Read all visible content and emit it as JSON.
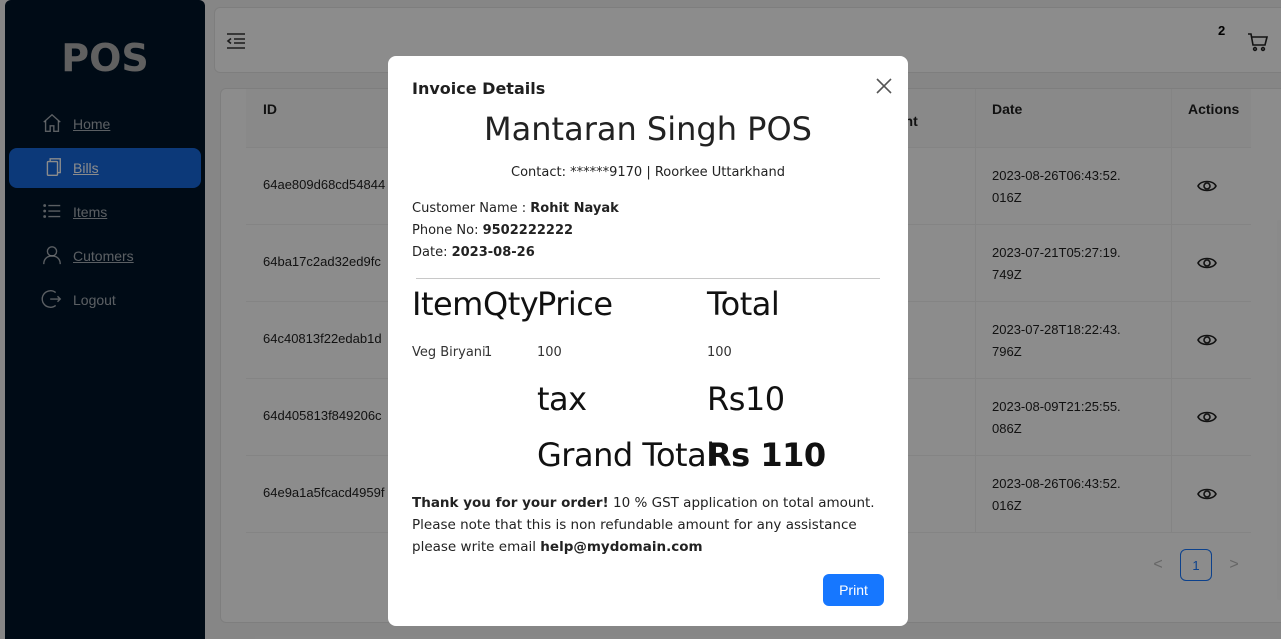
{
  "app": {
    "logo": "POS"
  },
  "sidebar": {
    "items": [
      {
        "label": "Home",
        "icon": "home-icon"
      },
      {
        "label": "Bills",
        "icon": "copy-icon"
      },
      {
        "label": "Items",
        "icon": "list-icon"
      },
      {
        "label": "Cutomers",
        "icon": "user-icon"
      },
      {
        "label": "Logout",
        "icon": "logout-icon"
      }
    ],
    "active_index": 1
  },
  "header": {
    "cart_count": "2"
  },
  "table": {
    "columns": [
      "ID",
      "Date",
      "Actions"
    ],
    "partial_column": "unt",
    "rows": [
      {
        "id": "64ae809d68cd54844",
        "date": "2023-08-26T06:43:52.016Z"
      },
      {
        "id": "64ba17c2ad32ed9fc",
        "date": "2023-07-21T05:27:19.749Z"
      },
      {
        "id": "64c40813f22edab1d",
        "date": "2023-07-28T18:22:43.796Z"
      },
      {
        "id": "64d405813f849206c",
        "date": "2023-08-09T21:25:55.086Z"
      },
      {
        "id": "64e9a1a5fcacd4959f",
        "date": "2023-08-26T06:43:52.016Z"
      }
    ]
  },
  "pagination": {
    "current": "1",
    "prev": "<",
    "next": ">"
  },
  "modal": {
    "title": "Invoice Details",
    "shop_name": "Mantaran Singh POS",
    "contact": "Contact: ******9170 | Roorkee Uttarkhand",
    "customer_label": "Customer Name : ",
    "customer_name": "Rohit Nayak",
    "phone_label": "Phone No: ",
    "phone": "9502222222",
    "date_label": "Date: ",
    "date": "2023-08-26",
    "headers": {
      "item": "Item",
      "qty": "Qty",
      "price": "Price",
      "total": "Total"
    },
    "line_item": {
      "item": "Veg Biryani",
      "qty": "1",
      "price": "100",
      "total": "100"
    },
    "tax_label": "tax",
    "tax_value": "Rs10",
    "grand_total_label": "Grand Total",
    "grand_total_value": "Rs 110",
    "thanks_bold": "Thank you for your order!",
    "thanks_text": " 10 % GST application on total amount. Please note that this is non refundable amount for any assistance please write email ",
    "email": "help@mydomain.com",
    "print_label": "Print"
  },
  "colors": {
    "sidebar_bg": "#001529",
    "accent": "#1677ff",
    "active_menu": "#1668dc"
  }
}
